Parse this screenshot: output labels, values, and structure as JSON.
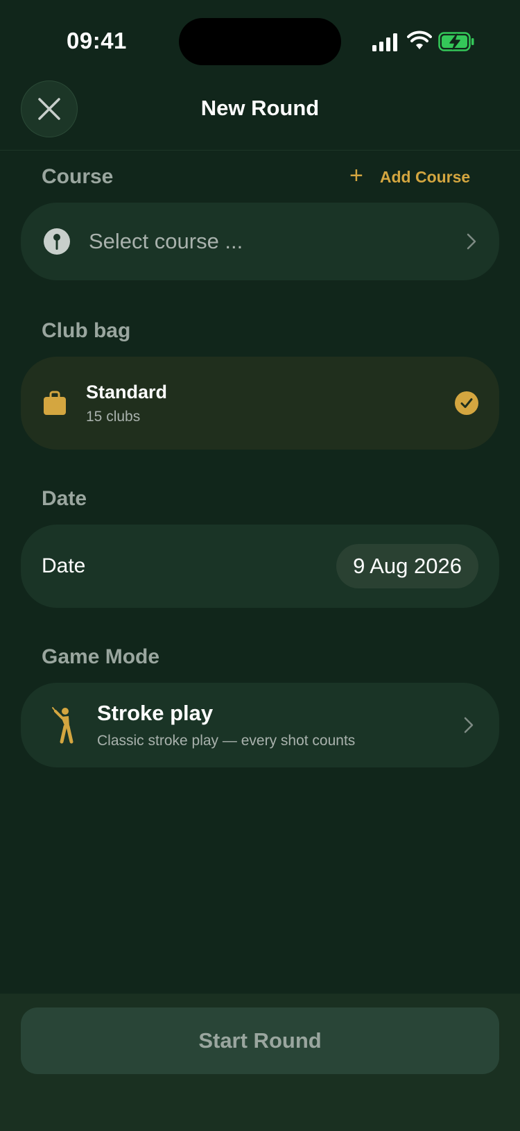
{
  "status_bar": {
    "time": "09:41"
  },
  "header": {
    "title": "New Round"
  },
  "course_section": {
    "label": "Course",
    "add_label": "Add Course",
    "add_symbol": "+",
    "placeholder": "Select course ..."
  },
  "club_bag_section": {
    "label": "Club bag",
    "bag_name": "Standard",
    "bag_detail": "15 clubs"
  },
  "date_section": {
    "label": "Date",
    "row_label": "Date",
    "value": "9 Aug 2026"
  },
  "game_mode_section": {
    "label": "Game Mode",
    "mode_name": "Stroke play",
    "mode_description": "Classic stroke play — every shot counts"
  },
  "footer": {
    "start_label": "Start Round"
  },
  "colors": {
    "background": "#11261b",
    "card": "#1a3426",
    "selected_card": "#202f1d",
    "accent": "#d4a640",
    "battery": "#34c759"
  },
  "icons": [
    "close-icon",
    "flag-pin-icon",
    "bag-icon",
    "checkmark-icon",
    "golfer-icon",
    "chevron-right-icon",
    "signal-icon",
    "wifi-icon",
    "battery-icon"
  ]
}
